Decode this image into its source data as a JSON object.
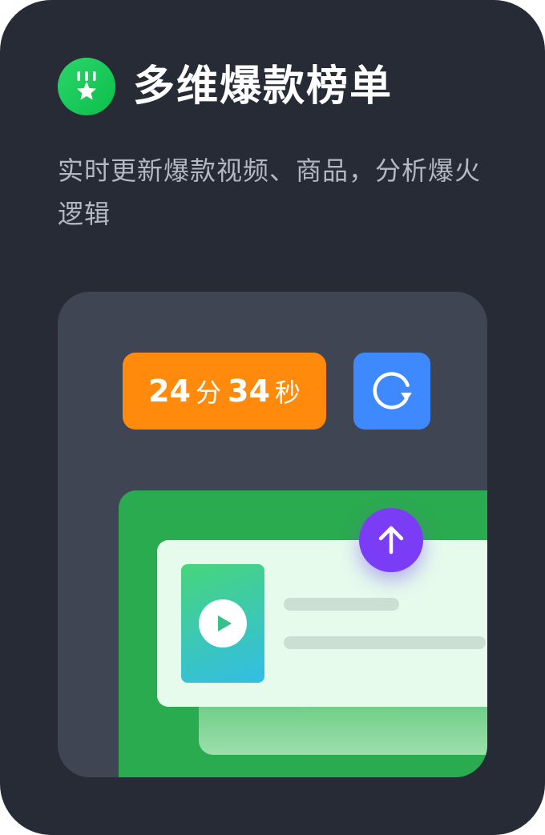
{
  "header": {
    "badge_icon": "medal-star-icon",
    "title": "多维爆款榜单",
    "subtitle": "实时更新爆款视频、商品，分析爆火逻辑"
  },
  "timer": {
    "minutes": "24",
    "minutes_unit": "分",
    "seconds": "34",
    "seconds_unit": "秒"
  },
  "icons": {
    "refresh": "refresh-icon",
    "upload": "arrow-up-icon",
    "play": "play-icon"
  },
  "colors": {
    "background": "#262b36",
    "panel": "#3f4553",
    "badge": "#0cbf4a",
    "timer": "#ff8a0c",
    "refresh": "#3f89ff",
    "green_area": "#2bab4f",
    "upload": "#7a3cf5"
  }
}
